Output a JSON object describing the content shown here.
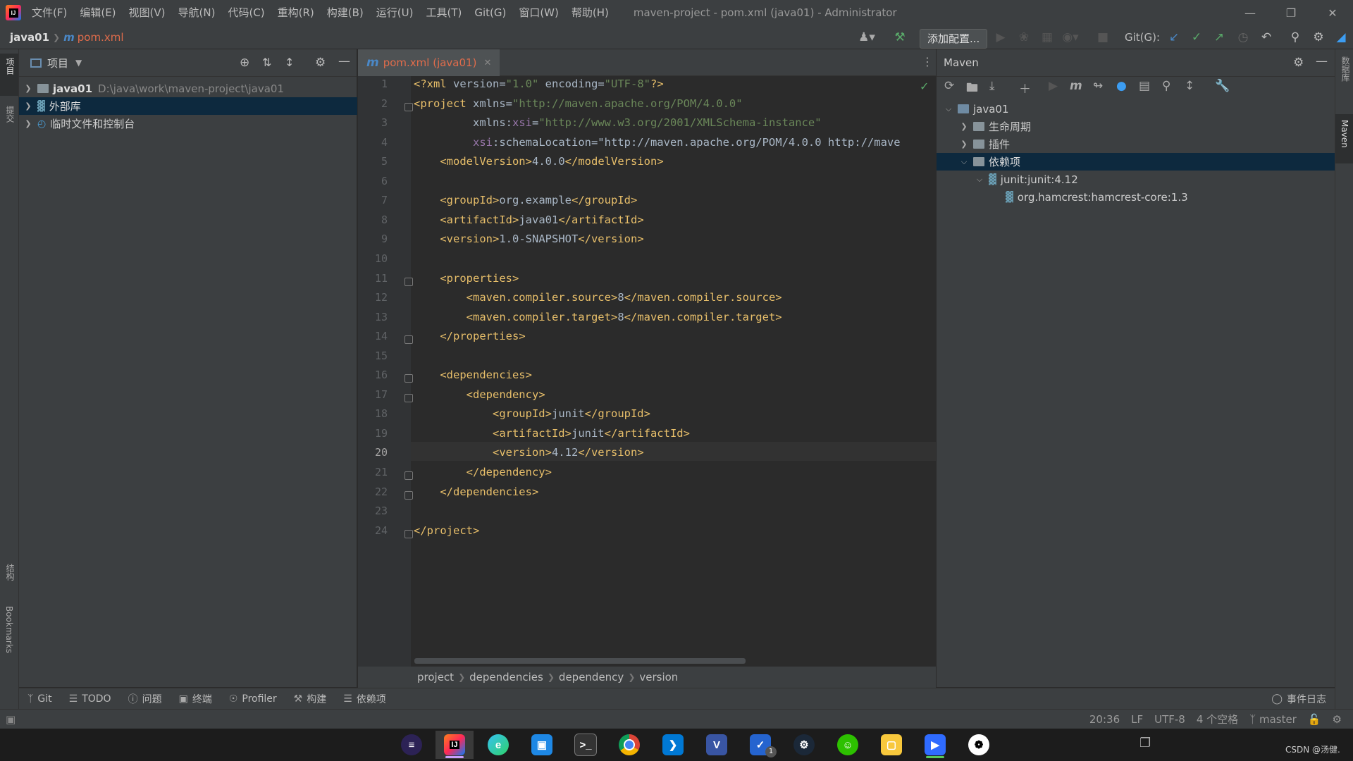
{
  "titlebar": {
    "menus": [
      "文件(F)",
      "编辑(E)",
      "视图(V)",
      "导航(N)",
      "代码(C)",
      "重构(R)",
      "构建(B)",
      "运行(U)",
      "工具(T)",
      "Git(G)",
      "窗口(W)",
      "帮助(H)"
    ],
    "window_title": "maven-project - pom.xml (java01) - Administrator"
  },
  "navbar": {
    "project": "java01",
    "file": "pom.xml",
    "add_config": "添加配置...",
    "git_label": "Git(G):"
  },
  "left_stripe": {
    "project": "项目",
    "commit": "提交",
    "structure": "结构",
    "bookmarks": "Bookmarks"
  },
  "project_panel": {
    "title": "项目",
    "tree": [
      {
        "label": "java01",
        "path": "D:\\java\\work\\maven-project\\java01"
      },
      {
        "label": "外部库"
      },
      {
        "label": "临时文件和控制台"
      }
    ]
  },
  "editor": {
    "tab": "pom.xml (java01)",
    "current_line": "20",
    "line_numbers": [
      "1",
      "2",
      "3",
      "4",
      "5",
      "6",
      "7",
      "8",
      "9",
      "10",
      "11",
      "12",
      "13",
      "14",
      "15",
      "16",
      "17",
      "18",
      "19",
      "20",
      "21",
      "22",
      "23",
      "24"
    ],
    "lines": [
      "<?xml version=\"1.0\" encoding=\"UTF-8\"?>",
      "<project xmlns=\"http://maven.apache.org/POM/4.0.0\"",
      "         xmlns:xsi=\"http://www.w3.org/2001/XMLSchema-instance\"",
      "         xsi:schemaLocation=\"http://maven.apache.org/POM/4.0.0 http://mave",
      "    <modelVersion>4.0.0</modelVersion>",
      "",
      "    <groupId>org.example</groupId>",
      "    <artifactId>java01</artifactId>",
      "    <version>1.0-SNAPSHOT</version>",
      "",
      "    <properties>",
      "        <maven.compiler.source>8</maven.compiler.source>",
      "        <maven.compiler.target>8</maven.compiler.target>",
      "    </properties>",
      "",
      "    <dependencies>",
      "        <dependency>",
      "            <groupId>junit</groupId>",
      "            <artifactId>junit</artifactId>",
      "            <version>4.12</version>",
      "        </dependency>",
      "    </dependencies>",
      "",
      "</project>"
    ],
    "breadcrumbs": [
      "project",
      "dependencies",
      "dependency",
      "version"
    ]
  },
  "maven": {
    "title": "Maven",
    "tree": [
      {
        "label": "java01"
      },
      {
        "label": "生命周期"
      },
      {
        "label": "插件"
      },
      {
        "label": "依赖项"
      },
      {
        "label": "junit:junit:4.12"
      },
      {
        "label": "org.hamcrest:hamcrest-core:1.3"
      }
    ],
    "right_stripe": [
      "数据库",
      "Maven"
    ]
  },
  "toolwindows": [
    "Git",
    "TODO",
    "问题",
    "终端",
    "Profiler",
    "构建",
    "依赖项"
  ],
  "event_log": "事件日志",
  "status": {
    "position": "20:36",
    "line_sep": "LF",
    "encoding": "UTF-8",
    "indent": "4 个空格",
    "branch": "master"
  },
  "taskbar": {
    "apps": [
      "eclipse",
      "intellij-idea",
      "edge",
      "screenshot",
      "terminal",
      "chrome",
      "vscode",
      "visio",
      "todo",
      "steam",
      "wechat",
      "explorer",
      "video",
      "game"
    ],
    "todo_badge": "1",
    "watermark": "CSDN @汤健."
  },
  "colors": {
    "accent": "#4a88c7",
    "tag": "#e8bf6a",
    "string": "#6a8759",
    "namespace": "#9876aa",
    "selection": "#0d293e"
  }
}
